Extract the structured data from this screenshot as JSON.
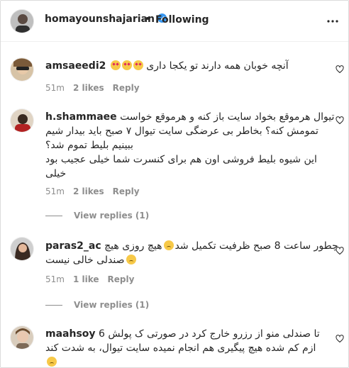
{
  "header": {
    "username": "homayounshajarian",
    "separator": "•",
    "follow_status": "Following",
    "more_icon": "more-horizontal-icon"
  },
  "comments": [
    {
      "username": "amsaeedi2",
      "text": "آنچه خوبان همه دارند تو یکجا داری",
      "emoji": "star-struck",
      "time": "51m",
      "likes": "2 likes",
      "reply": "Reply"
    },
    {
      "username": "h.shammaee",
      "text_line1": "تیوال هرموقع بخواد سایت باز کنه و هرموقع خواست",
      "text_line2": "تمومش کنه؟ بخاطر بی عرضگی سایت تیوال ۷ صبح باید بیدار شیم",
      "text_line3": "ببینیم بلیط تموم شد؟",
      "text_line4": "این شیوه بلیط فروشی اون هم برای کنسرت شما خیلی عجیب بود",
      "text_line5": "خیلی",
      "time": "51m",
      "likes": "2 likes",
      "reply": "Reply",
      "view_replies": "View replies (1)"
    },
    {
      "username": "paras2_ac",
      "text_line1": "چطور ساعت 8 صبح ظرفیت تکمیل شد",
      "text_line1b": "هیچ روزی هیچ",
      "text_line2": "صندلی خالی نیست",
      "time": "51m",
      "likes": "1 like",
      "reply": "Reply",
      "view_replies": "View replies (1)"
    },
    {
      "username": "maahsoy",
      "text_line1": "تا صندلی منو از رزرو خارج کرد در صورتی ک پولش 6",
      "text_line2": "ازم کم شده هیچ پیگیری هم انجام نمیده سایت تیوال، به شدت کند",
      "text_line3": ""
    }
  ]
}
